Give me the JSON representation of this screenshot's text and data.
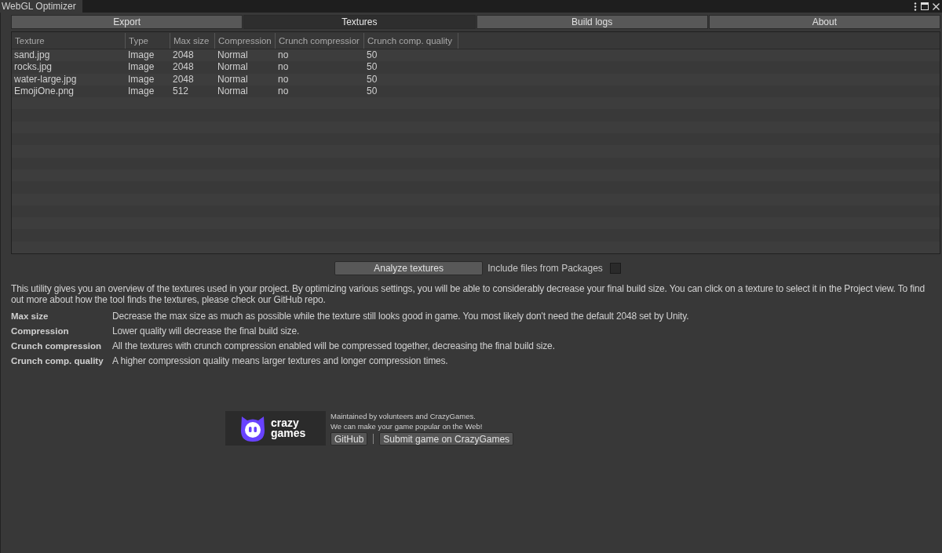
{
  "window": {
    "title": "WebGL Optimizer"
  },
  "tabs": [
    {
      "label": "Export",
      "selected": false
    },
    {
      "label": "Textures",
      "selected": true
    },
    {
      "label": "Build logs",
      "selected": false
    },
    {
      "label": "About",
      "selected": false
    }
  ],
  "table": {
    "columns": [
      "Texture",
      "Type",
      "Max size",
      "Compression",
      "Crunch compressior",
      "Crunch comp. quality"
    ],
    "rows": [
      [
        "sand.jpg",
        "Image",
        "2048",
        "Normal",
        "no",
        "50"
      ],
      [
        "rocks.jpg",
        "Image",
        "2048",
        "Normal",
        "no",
        "50"
      ],
      [
        "water-large.jpg",
        "Image",
        "2048",
        "Normal",
        "no",
        "50"
      ],
      [
        "EmojiOne.png",
        "Image",
        "512",
        "Normal",
        "no",
        "50"
      ]
    ]
  },
  "analyze_button": "Analyze textures",
  "include_packages": {
    "label": "Include files from Packages",
    "checked": false
  },
  "description": "This utility gives you an overview of the textures used in your project. By optimizing various settings, you will be able to considerably decrease your final build size. You can click on a texture to select it in the Project view. To find out more about how the tool finds the textures, please check our GitHub repo.",
  "definitions": [
    {
      "term": "Max size",
      "text": "Decrease the max size as much as possible while the texture still looks good in game. You most likely don't need the default 2048 set by Unity."
    },
    {
      "term": "Compression",
      "text": "Lower quality will decrease the final build size."
    },
    {
      "term": "Crunch compression",
      "text": "All the textures with crunch compression enabled will be compressed together, decreasing the final build size."
    },
    {
      "term": "Crunch comp. quality",
      "text": "A higher compression quality means larger textures and longer compression times."
    }
  ],
  "footer": {
    "logo_text": [
      "crazy",
      "games"
    ],
    "lines": [
      "Maintained by volunteers and CrazyGames.",
      "We can make your game popular on the Web!"
    ],
    "buttons": [
      "GitHub",
      "Submit game on CrazyGames"
    ]
  }
}
